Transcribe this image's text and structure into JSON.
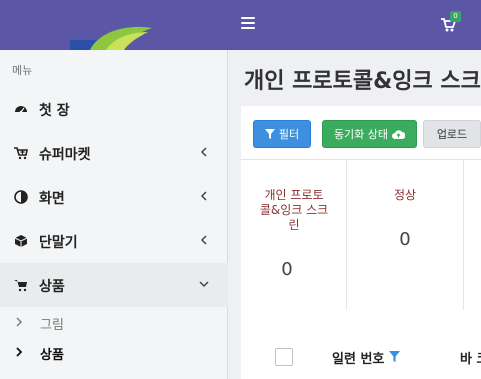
{
  "topbar": {
    "cart_badge": "0"
  },
  "sidebar": {
    "header": "메뉴",
    "items": [
      {
        "label": "첫 장",
        "icon": "dashboard-icon"
      },
      {
        "label": "슈퍼마켓",
        "icon": "cart-plus-icon"
      },
      {
        "label": "화면",
        "icon": "half-circle-icon"
      },
      {
        "label": "단말기",
        "icon": "cube-icon"
      },
      {
        "label": "상품",
        "icon": "cart-icon"
      }
    ],
    "subitems": [
      {
        "label": "그림"
      },
      {
        "label": "상품"
      }
    ]
  },
  "main": {
    "title": "개인 프로토콜&잉크 스크",
    "buttons": {
      "filter": "필터",
      "sync": "동기화 상태",
      "upload": "업로드"
    },
    "stats": [
      {
        "label": "개인 프로토\n콜&잉크 스크\n린",
        "value": "0"
      },
      {
        "label": "정상",
        "value": "0"
      }
    ],
    "table": {
      "col_serial": "일련 번호",
      "col_next": "바 코"
    }
  },
  "colors": {
    "topbar": "#5b57a6",
    "filter_btn": "#3d8fe0",
    "sync_btn": "#3bab5d",
    "stat_label": "#8a3030"
  }
}
